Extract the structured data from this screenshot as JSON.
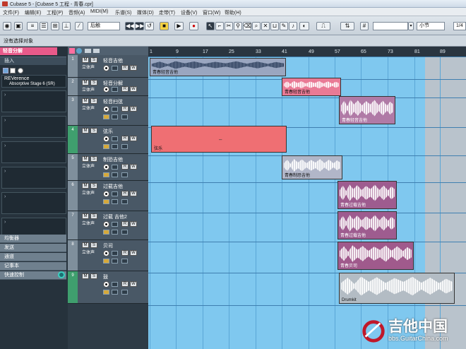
{
  "window": {
    "title": "Cubase 5 - [Cubase 5 工程 - 青春.cpr]",
    "icon": "cubase-app-icon"
  },
  "menu": [
    "文件(F)",
    "编辑(E)",
    "工程(P)",
    "音频(A)",
    "MIDI(M)",
    "乐谱(S)",
    "媒体(D)",
    "走带(T)",
    "设备(V)",
    "窗口(W)",
    "帮助(H)"
  ],
  "toolbar": {
    "mode_select": "后触",
    "snap_select": "小节",
    "right_value": "1/4",
    "icons": [
      "activate-project-icon",
      "constrain-delay-icon",
      "automation-icon",
      "rewind-icon",
      "forward-icon",
      "cycle-icon",
      "stop-icon",
      "play-icon",
      "record-icon",
      "arrow-tool-icon",
      "range-tool-icon",
      "split-tool-icon",
      "glue-tool-icon",
      "erase-tool-icon",
      "zoom-tool-icon",
      "mute-tool-icon",
      "time-warp-icon",
      "draw-tool-icon",
      "play-tool-icon",
      "color-tool-icon",
      "snap-icon",
      "quantize-icon",
      "grid-icon"
    ]
  },
  "info_line": "没有选择对象",
  "inspector": {
    "track_name": "轻音分解",
    "insert_label": "插入",
    "plugin_name": "REVerence",
    "plugin_preset": "Absorptive Stage 6 (SR)",
    "lower_sections": [
      "均衡器",
      "发送",
      "通道",
      "记事本",
      "快速控制"
    ]
  },
  "tracks": [
    {
      "num": "1",
      "name": "轻音吉他",
      "sub": "立体声"
    },
    {
      "num": "2",
      "name": "轻音分解",
      "sub": "立体声"
    },
    {
      "num": "3",
      "name": "轻音扫弦",
      "sub": "立体声"
    },
    {
      "num": "4",
      "name": "弦乐",
      "sub": ""
    },
    {
      "num": "5",
      "name": "制恐吉他",
      "sub": "立体声"
    },
    {
      "num": "6",
      "name": "过载吉他",
      "sub": "立体声"
    },
    {
      "num": "7",
      "name": "过载 吉他2",
      "sub": "立体声"
    },
    {
      "num": "8",
      "name": "贝司",
      "sub": "立体声"
    },
    {
      "num": "9",
      "name": "鼓",
      "sub": ""
    }
  ],
  "ruler": [
    "1",
    "9",
    "17",
    "25",
    "33",
    "41",
    "49",
    "57",
    "65",
    "73",
    "81",
    "89"
  ],
  "parts": [
    {
      "label": "青春轻音吉他",
      "color": "#9aa6c0"
    },
    {
      "label": "青春轻音吉他",
      "color": "#e97a95"
    },
    {
      "label": "青春轻音吉他",
      "color": "#b07aa6"
    },
    {
      "label": "弦乐",
      "color": "#ef6f73",
      "marker": "–"
    },
    {
      "label": "青春制恐吉他",
      "color": "#b1b6c8"
    },
    {
      "label": "青春过载吉他",
      "color": "#9e5c8f"
    },
    {
      "label": "青春过载吉他",
      "color": "#9e5c8f"
    },
    {
      "label": "青春贝司",
      "color": "#a05a8c"
    },
    {
      "label": "Drumkit",
      "color": "#b3bcc4"
    }
  ],
  "watermark": {
    "text": "吉他中国",
    "url": "bbs.GuitarChina.com"
  }
}
